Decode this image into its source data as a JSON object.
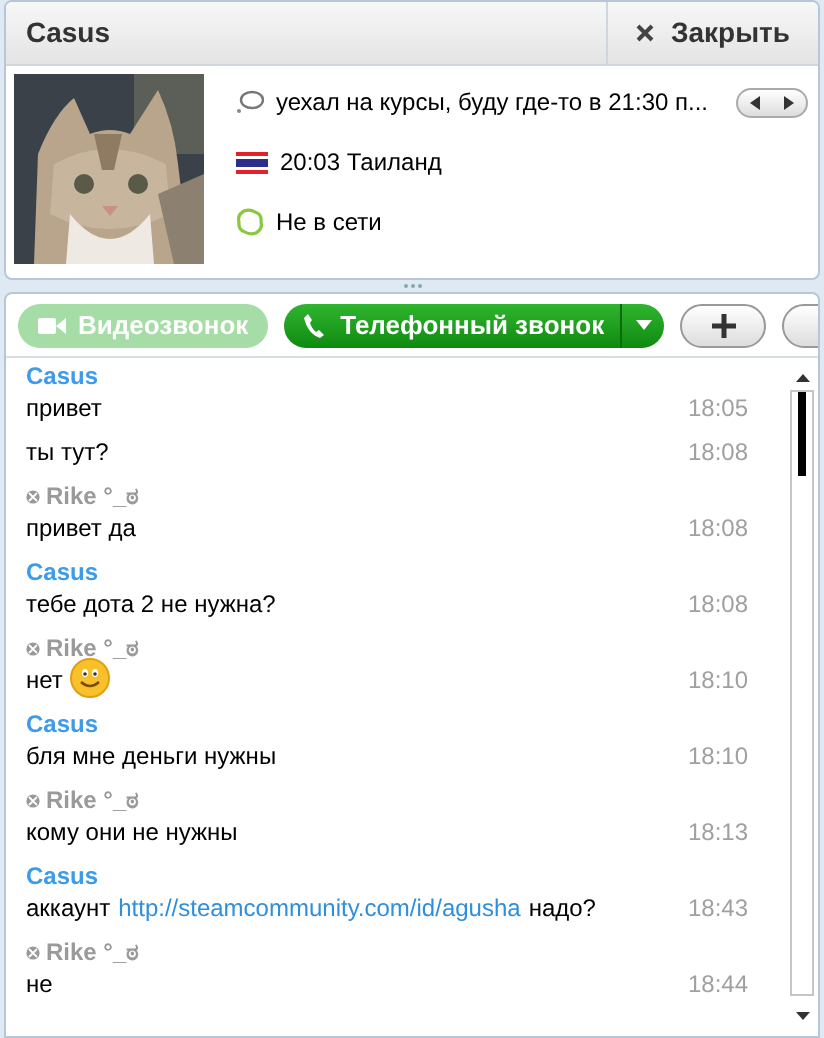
{
  "header": {
    "title": "Casus",
    "close_label": "Закрыть"
  },
  "profile": {
    "mood": "уехал на курсы, буду где-то в 21:30 п...",
    "local_time": "20:03 Таиланд",
    "status": "Не в сети"
  },
  "toolbar": [
    {
      "kind": "video",
      "label": "Видеозвонок",
      "disabled": true
    },
    {
      "kind": "phone",
      "label": "Телефонный звонок",
      "disabled": false
    },
    {
      "kind": "add",
      "disabled": false
    },
    {
      "kind": "partial",
      "disabled": false
    }
  ],
  "messages": [
    {
      "kind": "contact",
      "sender": "Casus",
      "lines": [
        {
          "segments": [
            {
              "kind": "text",
              "text": "привет"
            }
          ],
          "time": "18:05"
        },
        {
          "segments": [
            {
              "kind": "text",
              "text": "ты тут?"
            }
          ],
          "time": "18:08"
        }
      ]
    },
    {
      "kind": "self",
      "sender": "Rike °_ಠ",
      "lines": [
        {
          "segments": [
            {
              "kind": "text",
              "text": "привет да"
            }
          ],
          "time": "18:08"
        }
      ]
    },
    {
      "kind": "contact",
      "sender": "Casus",
      "lines": [
        {
          "segments": [
            {
              "kind": "text",
              "text": "тебе дота 2 не нужна?"
            }
          ],
          "time": "18:08"
        }
      ]
    },
    {
      "kind": "self",
      "sender": "Rike °_ಠ",
      "lines": [
        {
          "segments": [
            {
              "kind": "text",
              "text": "нет"
            },
            {
              "kind": "emoticon"
            }
          ],
          "time": "18:10"
        }
      ]
    },
    {
      "kind": "contact",
      "sender": "Casus",
      "lines": [
        {
          "segments": [
            {
              "kind": "text",
              "text": "бля мне деньги нужны"
            }
          ],
          "time": "18:10"
        }
      ]
    },
    {
      "kind": "self",
      "sender": "Rike °_ಠ",
      "lines": [
        {
          "segments": [
            {
              "kind": "text",
              "text": "кому они не нужны"
            }
          ],
          "time": "18:13"
        }
      ]
    },
    {
      "kind": "contact",
      "sender": "Casus",
      "lines": [
        {
          "segments": [
            {
              "kind": "text",
              "text": "аккаунт"
            },
            {
              "kind": "link",
              "text": "http://steamcommunity.com/id/agusha"
            },
            {
              "kind": "text",
              "text": "надо?"
            }
          ],
          "time": "18:43"
        }
      ]
    },
    {
      "kind": "self",
      "sender": "Rike °_ಠ",
      "lines": [
        {
          "segments": [
            {
              "kind": "text",
              "text": "не"
            }
          ],
          "time": "18:44"
        }
      ]
    }
  ]
}
